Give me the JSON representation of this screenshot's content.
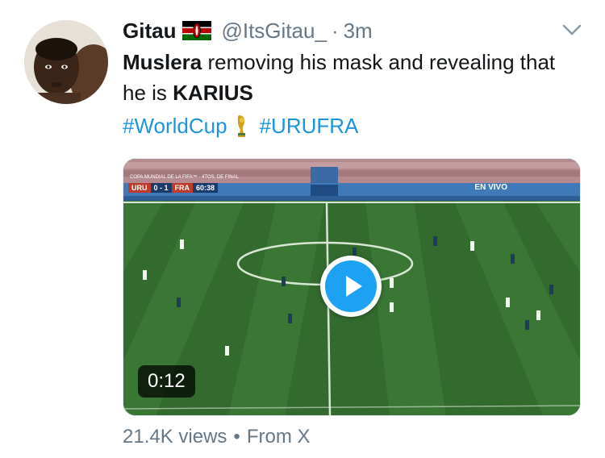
{
  "tweet": {
    "author_name": "Gitau",
    "author_flag": "kenya-flag-icon",
    "handle": "@ItsGitau_",
    "separator": "·",
    "time": "3m",
    "text_bold_1": "Muslera",
    "text_mid": " removing his mask and revealing that he is ",
    "text_bold_2": "KARIUS",
    "hashtag_1": "#WorldCup",
    "hashtag_2": "#URUFRA",
    "hashtag_color": "#1b95e0"
  },
  "media": {
    "duration": "0:12",
    "play_icon": "play-icon",
    "scoreboard": {
      "competition": "COPA MUNDIAL DE LA FIFA™ · 4TOS. DE FINAL",
      "team_1": "URU",
      "score": "0 - 1",
      "team_2": "FRA",
      "clock": "60:38"
    },
    "live_label": "EN VIVO"
  },
  "footer": {
    "views": "21.4K views",
    "separator": "•",
    "source": "From X"
  },
  "colors": {
    "accent": "#1da1f2",
    "secondary_text": "#657786"
  }
}
